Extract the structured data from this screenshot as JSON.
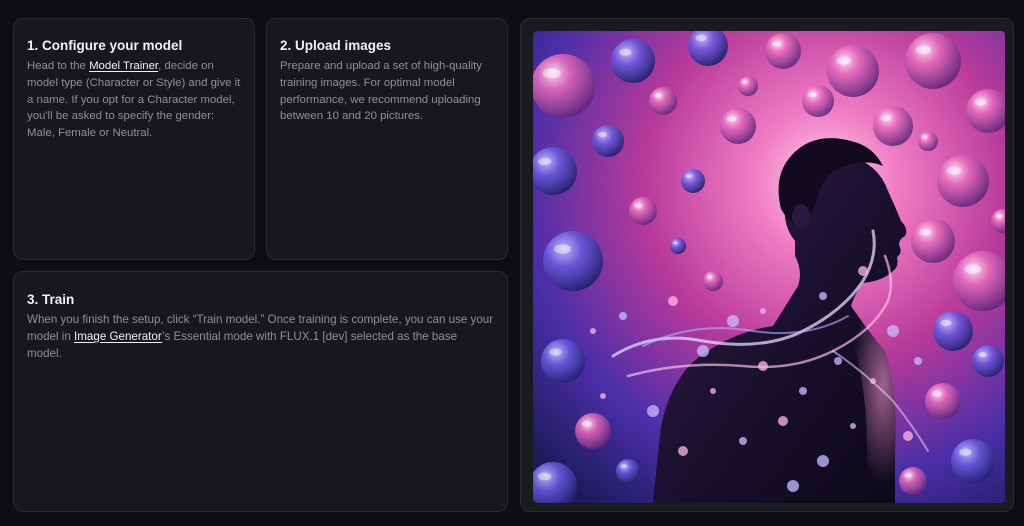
{
  "steps": [
    {
      "title": "1. Configure your model",
      "text_before": "Head to the ",
      "link": "Model Trainer",
      "text_after": ", decide on model type (Character or Style) and give it a name. If you opt for a Character model, you'll be asked to specify the gender: Male, Female or Neutral."
    },
    {
      "title": "2. Upload images",
      "text": "Prepare and upload a set of high-quality training images. For optimal model performance, we recommend uploading between 10 and 20 pictures."
    },
    {
      "title": "3. Train",
      "text_before": "When you finish the setup, click “Train model.” Once training is complete, you can use your model in ",
      "link": "Image Generator",
      "text_after": "’s Essential mode with FLUX.1 [dev] selected as the base model."
    }
  ],
  "colors": {
    "background": "#0d0e11",
    "card": "#17181c",
    "heading": "#f2f2f4",
    "body": "#8e9099",
    "image_magenta": "#d63fa0",
    "image_blue": "#3a3fd8"
  }
}
